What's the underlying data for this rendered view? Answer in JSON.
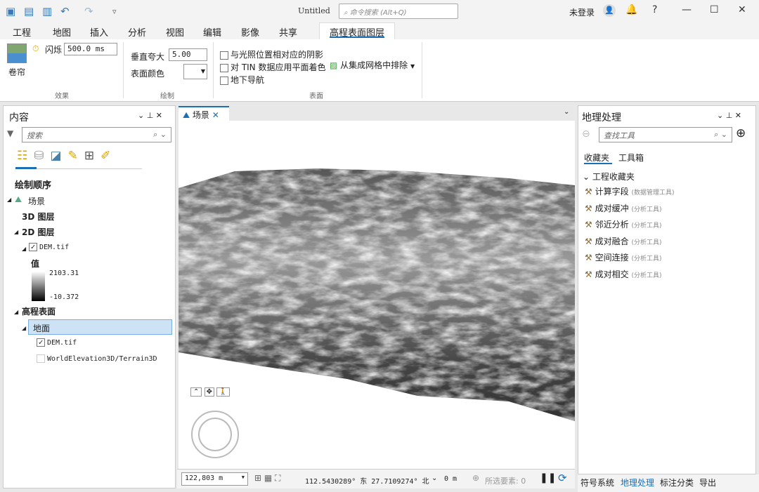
{
  "app": {
    "title": "Untitled",
    "command_search_placeholder": "命令搜索 (Alt+Q)",
    "user": "未登录"
  },
  "quick_access": [
    "new-project-icon",
    "open-icon",
    "save-icon",
    "undo-icon",
    "redo-icon",
    "customize-icon"
  ],
  "tabs": [
    "工程",
    "地图",
    "插入",
    "分析",
    "视图",
    "编辑",
    "影像",
    "共享",
    "高程表面图层"
  ],
  "ribbon": {
    "effects": {
      "swipe_label": "卷帘",
      "flicker_label": "闪烁",
      "flicker_value": "500.0  ms",
      "group": "效果"
    },
    "drawing": {
      "vexag_label": "垂直夸大",
      "vexag_value": "5.00",
      "color_label": "表面颜色",
      "group": "绘制"
    },
    "surface": {
      "shade": "与光照位置相对应的阴影",
      "tin": "对 TIN 数据应用平面着色",
      "underground": "地下导航",
      "exclude": "从集成网格中排除",
      "group": "表面"
    }
  },
  "contents": {
    "title": "内容",
    "search_placeholder": "搜索",
    "heading": "绘制顺序",
    "scene": "场景",
    "layers3d": "3D 图层",
    "layers2d": "2D 图层",
    "dem": "DEM.tif",
    "legend_title": "值",
    "legend_max": "2103.31",
    "legend_min": "-10.372",
    "elevation": "高程表面",
    "ground": "地面",
    "ground_dem": "DEM.tif",
    "world": "WorldElevation3D/Terrain3D"
  },
  "scene_tab": "场景",
  "status": {
    "scale": "122,803 m",
    "coords": "112.5430289° 东 27.7109274° 北",
    "elev": "0 m",
    "selected": "所选要素: 0"
  },
  "geoprocessing": {
    "title": "地理处理",
    "search_placeholder": "查找工具",
    "tabs": [
      "收藏夹",
      "工具箱"
    ],
    "folder": "工程收藏夹",
    "tools": [
      {
        "name": "计算字段",
        "box": "(数据管理工具)"
      },
      {
        "name": "成对缓冲",
        "box": "(分析工具)"
      },
      {
        "name": "邻近分析",
        "box": "(分析工具)"
      },
      {
        "name": "成对融合",
        "box": "(分析工具)"
      },
      {
        "name": "空间连接",
        "box": "(分析工具)"
      },
      {
        "name": "成对相交",
        "box": "(分析工具)"
      }
    ]
  },
  "bottom_tabs": [
    "符号系统",
    "地理处理",
    "标注分类",
    "导出"
  ],
  "colors": {
    "accent": "#1b6fb5",
    "selection": "#cde3f5"
  }
}
